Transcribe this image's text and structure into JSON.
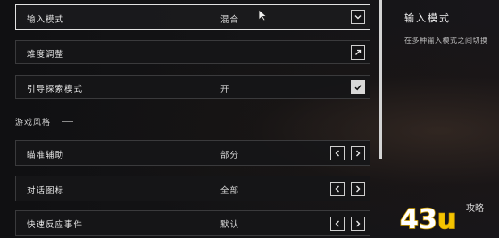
{
  "settings": {
    "rows": [
      {
        "label": "输入模式",
        "value": "混合",
        "control": "dropdown-icon"
      },
      {
        "label": "难度调整",
        "value": "",
        "control": "external-link-icon"
      },
      {
        "label": "引导探索模式",
        "value": "开",
        "control": "checkbox-checked-icon",
        "checked": true
      },
      {
        "label": "瞄准辅助",
        "value": "部分",
        "control": "arrow-pair"
      },
      {
        "label": "对话图标",
        "value": "全部",
        "control": "arrow-pair"
      },
      {
        "label": "快速反应事件",
        "value": "默认",
        "control": "arrow-pair"
      }
    ],
    "section_header": "游戏风格",
    "selected_index": 0
  },
  "detail": {
    "title": "输入模式",
    "description": "在多种输入模式之间切换"
  },
  "icons": {
    "dropdown": "chevron-down",
    "external": "arrow-up-right",
    "check": "checkmark",
    "left": "chevron-left",
    "right": "chevron-right"
  },
  "watermark": {
    "text_digits": "43",
    "text_u": "u",
    "text_small": "攻略"
  },
  "colors": {
    "border_selected": "#e2e2e2",
    "border_default": "#3a3a3c",
    "watermark_yellow": "#f5c400"
  }
}
